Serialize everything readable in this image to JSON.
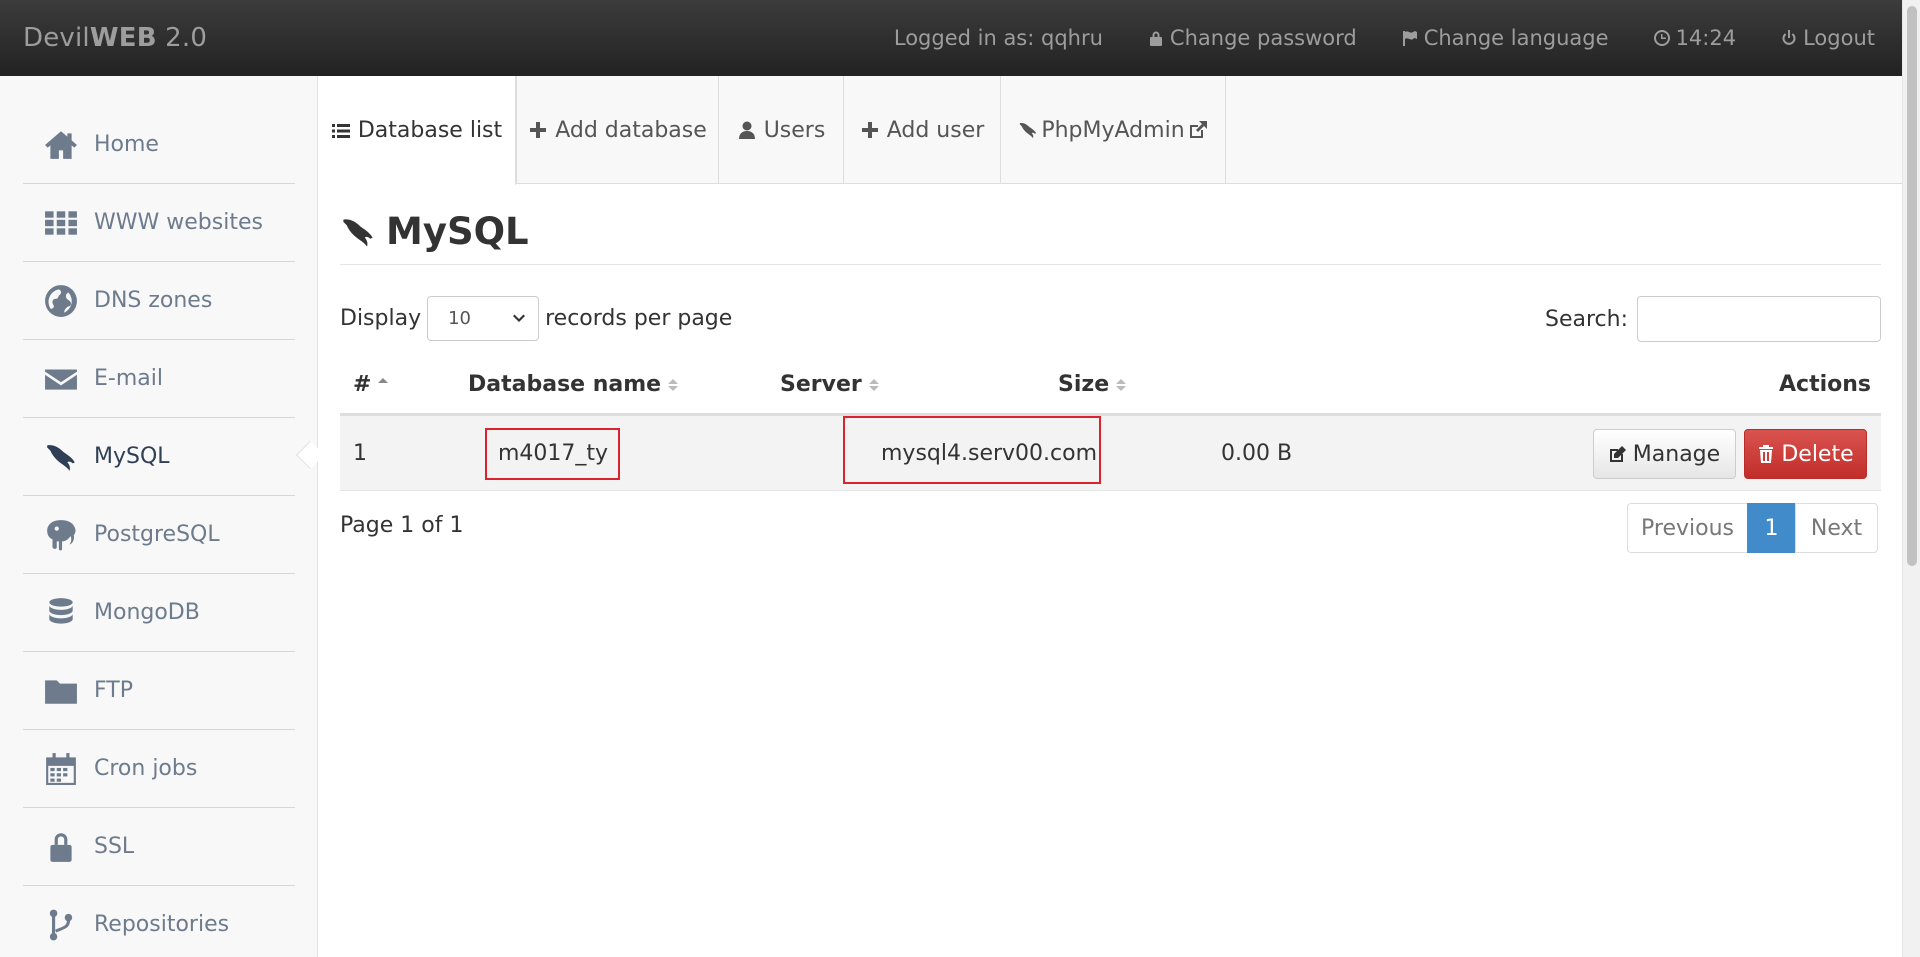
{
  "header": {
    "brand_light": "Devil",
    "brand_bold": "WEB",
    "brand_version": " 2.0",
    "logged_in": "Logged in as: qqhru",
    "change_password": "Change password",
    "change_language": "Change language",
    "time": "14:24",
    "logout": "Logout"
  },
  "sidebar": {
    "items": [
      {
        "label": "Home",
        "icon": "home-icon"
      },
      {
        "label": "WWW websites",
        "icon": "grid-icon"
      },
      {
        "label": "DNS zones",
        "icon": "globe-icon"
      },
      {
        "label": "E-mail",
        "icon": "envelope-icon"
      },
      {
        "label": "MySQL",
        "icon": "dolphin-icon",
        "active": true
      },
      {
        "label": "PostgreSQL",
        "icon": "elephant-icon"
      },
      {
        "label": "MongoDB",
        "icon": "database-icon"
      },
      {
        "label": "FTP",
        "icon": "folder-icon"
      },
      {
        "label": "Cron jobs",
        "icon": "calendar-icon"
      },
      {
        "label": "SSL",
        "icon": "lock-icon"
      },
      {
        "label": "Repositories",
        "icon": "branch-icon"
      }
    ]
  },
  "tabs": {
    "database_list": "Database list",
    "add_database": "Add database",
    "users": "Users",
    "add_user": "Add user",
    "phpmyadmin": "PhpMyAdmin"
  },
  "main": {
    "title": "MySQL",
    "display_label": "Display",
    "per_page_value": "10",
    "records_label": "records per page",
    "search_label": "Search:",
    "search_value": ""
  },
  "table": {
    "columns": [
      "#",
      "Database name",
      "Server",
      "Size",
      "Actions"
    ],
    "rows": [
      {
        "num": "1",
        "name": "m4017_ty",
        "server": "mysql4.serv00.com",
        "size": "0.00 B"
      }
    ],
    "manage_label": "Manage",
    "delete_label": "Delete"
  },
  "pagination": {
    "info": "Page 1 of 1",
    "previous": "Previous",
    "current": "1",
    "next": "Next"
  },
  "colors": {
    "navbar": "#222222",
    "sidebar_text": "#6d7b8d",
    "highlight_box": "#d9232e",
    "delete_button": "#d9534f",
    "pager_active": "#428bca"
  }
}
